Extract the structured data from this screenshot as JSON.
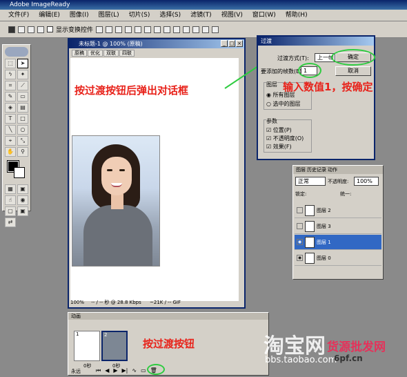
{
  "window_title": "Adobe ImageReady",
  "menu": [
    "文件(F)",
    "编辑(E)",
    "图像(I)",
    "图层(L)",
    "切片(S)",
    "选择(S)",
    "滤镜(T)",
    "视图(V)",
    "窗口(W)",
    "帮助(H)"
  ],
  "options_bar": {
    "show_transform_label": "显示变换控件"
  },
  "document": {
    "title": "未标题-1 @ 100% (原稿)",
    "tabs": [
      "原稿",
      "优化",
      "双联",
      "四联"
    ],
    "status_zoom": "100%",
    "status_size": "-- / -- 秒 @ 28.8 Kbps",
    "status_dims": "~21K / -- GIF"
  },
  "annotation_red": "按过渡按钮后弹出对话框",
  "annotation_dialog_red": "输入数值1，按确定",
  "annotation_anim_red": "按过渡按钮",
  "dialog": {
    "title": "过渡",
    "tween_with_label": "过渡方式(T):",
    "tween_with_value": "上一帧",
    "frames_label": "要添加的帧数(E):",
    "frames_value": "1",
    "ok": "确定",
    "cancel": "取消",
    "layers_group": "图层",
    "layer_opt1": "所有图层",
    "layer_opt2": "选中的图层",
    "params_group": "参数",
    "param1": "位置(P)",
    "param2": "不透明度(O)",
    "param3": "效果(F)"
  },
  "layers_panel": {
    "tabs": [
      "图层",
      "历史记录",
      "动作"
    ],
    "blend": "正常",
    "opacity_label": "不透明度:",
    "opacity_value": "100%",
    "lock_label": "锁定:",
    "unify_label": "统一:",
    "layers": [
      {
        "name": "图层 2",
        "selected": false
      },
      {
        "name": "图层 3",
        "selected": false
      },
      {
        "name": "图层 1",
        "selected": true
      },
      {
        "name": "图层 0",
        "selected": false
      }
    ]
  },
  "animation_panel": {
    "title": "动画",
    "frame1_num": "1",
    "frame2_num": "2",
    "frame1_delay": "0秒",
    "frame2_delay": "0秒",
    "loop": "永远"
  },
  "watermark": {
    "taobao": "淘宝网",
    "url": "bbs.taobao.com",
    "brand": "货源批发网",
    "brand_url": "6pf.cn"
  },
  "colors": {
    "annotation": "#e8221a",
    "highlight_ring": "#2ecc40",
    "selection": "#3168c4",
    "titlebar": "#0a246a"
  }
}
